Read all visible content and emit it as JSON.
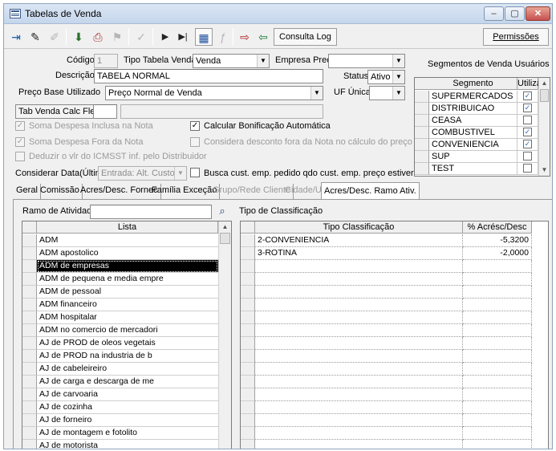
{
  "window": {
    "title": "Tabelas de Venda",
    "controls": [
      "–",
      "▢",
      "✕"
    ]
  },
  "toolbar": {
    "consulta_log": "Consulta Log",
    "permissoes": "Permissões"
  },
  "form": {
    "codigo_label": "Código",
    "codigo_value": "1",
    "tipo_tabela_label": "Tipo Tabela Venda",
    "tipo_tabela_value": "Venda",
    "empresa_preco_label": "Empresa Preço",
    "empresa_preco_value": "",
    "descricao_label": "Descrição",
    "descricao_value": "TABELA NORMAL",
    "status_label": "Status",
    "status_value": "Ativo",
    "preco_base_label": "Preço Base Utilizado",
    "preco_base_value": "Preço Normal de Venda",
    "uf_unica_label": "UF Única",
    "uf_unica_value": "",
    "tab_venda_calc_flex_label": "Tab Venda Calc Flex",
    "tab_venda_calc_flex_value": "",
    "soma_despesa_inclusa_label": "Soma Despesa Inclusa na Nota",
    "soma_despesa_fora_label": "Soma Despesa Fora da Nota",
    "deduzir_icmsst_label": "Deduzir o vlr do ICMSST inf. pelo Distribuidor",
    "calcular_bonificacao_label": "Calcular Bonificação Automática",
    "considera_desconto_label": "Considera desconto fora da Nota no cálculo do preço",
    "considerar_data_label": "Considerar Data(Última)",
    "considerar_data_value": "Entrada: Alt. Custo",
    "busca_cust_label": "Busca cust. emp. pedido qdo cust. emp. preço estiver zerado",
    "checks": {
      "soma_despesa_inclusa": true,
      "soma_despesa_fora": true,
      "deduzir_icmsst": false,
      "calcular_bonificacao": true,
      "considera_desconto": false,
      "busca_cust": false
    }
  },
  "segmentos": {
    "title": "Segmentos de Venda Usuários",
    "col_segmento": "Segmento",
    "col_utiliza": "Utiliza",
    "rows": [
      {
        "name": "SUPERMERCADOS",
        "utiliza": true
      },
      {
        "name": "DISTRIBUICAO",
        "utiliza": true
      },
      {
        "name": "CEASA",
        "utiliza": false
      },
      {
        "name": "COMBUSTIVEL",
        "utiliza": true
      },
      {
        "name": "CONVENIENCIA",
        "utiliza": true
      },
      {
        "name": "SUP",
        "utiliza": false
      },
      {
        "name": "TEST",
        "utiliza": false
      }
    ]
  },
  "tabs": [
    {
      "label": "Geral",
      "state": "normal"
    },
    {
      "label": "Comissão",
      "state": "normal"
    },
    {
      "label": "Acres/Desc. Fornec",
      "state": "normal"
    },
    {
      "label": "Família Exceção",
      "state": "normal"
    },
    {
      "label": "Grupo/Rede Cliente",
      "state": "dim"
    },
    {
      "label": "Cidade/UF",
      "state": "dim"
    },
    {
      "label": "Acres/Desc. Ramo Ativ.",
      "state": "active"
    }
  ],
  "ramo": {
    "label": "Ramo de Atividade",
    "search_value": "",
    "col_lista": "Lista",
    "items": [
      "ADM",
      "ADM apostolico",
      "ADM de empresas",
      "ADM de pequena e media empre",
      "ADM de pessoal",
      "ADM financeiro",
      "ADM hospitalar",
      "ADM no comercio de mercadori",
      "AJ de PROD de oleos vegetais",
      "AJ de PROD na industria de b",
      "AJ de cabeleireiro",
      "AJ de carga e descarga de me",
      "AJ de carvoaria",
      "AJ de cozinha",
      "AJ de forneiro",
      "AJ de montagem e fotolito",
      "AJ de motorista"
    ],
    "selected_index": 2
  },
  "classificacao": {
    "label": "Tipo de Classificação",
    "col_tipo": "Tipo Classificação",
    "col_acresc": "% Acrésc/Desc",
    "rows": [
      {
        "tipo": "2-CONVENIENCIA",
        "valor": "-5,3200"
      },
      {
        "tipo": "3-ROTINA",
        "valor": "-2,0000"
      }
    ]
  }
}
